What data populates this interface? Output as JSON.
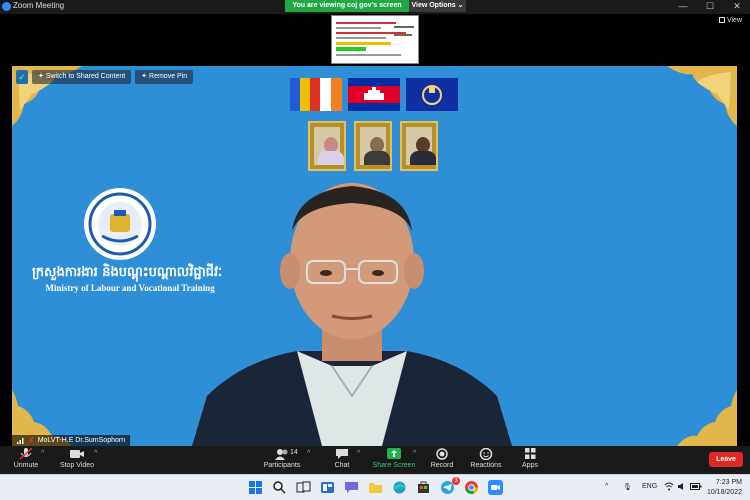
{
  "window": {
    "app_title": "Zoom Meeting",
    "viewing_banner": "You are viewing coj gov's screen",
    "view_options": "View Options",
    "view_options_caret": "⌄",
    "view_label": "View",
    "controls": {
      "minimize": "—",
      "maximize": "☐",
      "close": "✕"
    }
  },
  "share_controls": {
    "switch_label": "Switch to Shared Content",
    "remove_pin_label": "Remove Pin"
  },
  "video": {
    "ministry_khmer": "ក្រសួងការងារ និងបណ្តុះបណ្តាលវិជ្ជាជីវៈ",
    "ministry_english": "Ministry of Labour and Vocational Training",
    "participant_name": "MoLVT-H.E Dr.SumSophorn",
    "background_color": "#2f8fd6"
  },
  "toolbar": {
    "unmute": "Unmute",
    "stop_video": "Stop Video",
    "participants": "Participants",
    "participants_count": "14",
    "chat": "Chat",
    "share_screen": "Share Screen",
    "record": "Record",
    "reactions": "Reactions",
    "apps": "Apps",
    "leave": "Leave",
    "caret": "^"
  },
  "taskbar": {
    "language": "ENG",
    "time": "7:23 PM",
    "date": "10/18/2022",
    "notification_badge": "3",
    "tray_caret": "^"
  },
  "colors": {
    "accent_green": "#22a745",
    "leave_red": "#e02828",
    "zoom_blue": "#2d8cff"
  }
}
